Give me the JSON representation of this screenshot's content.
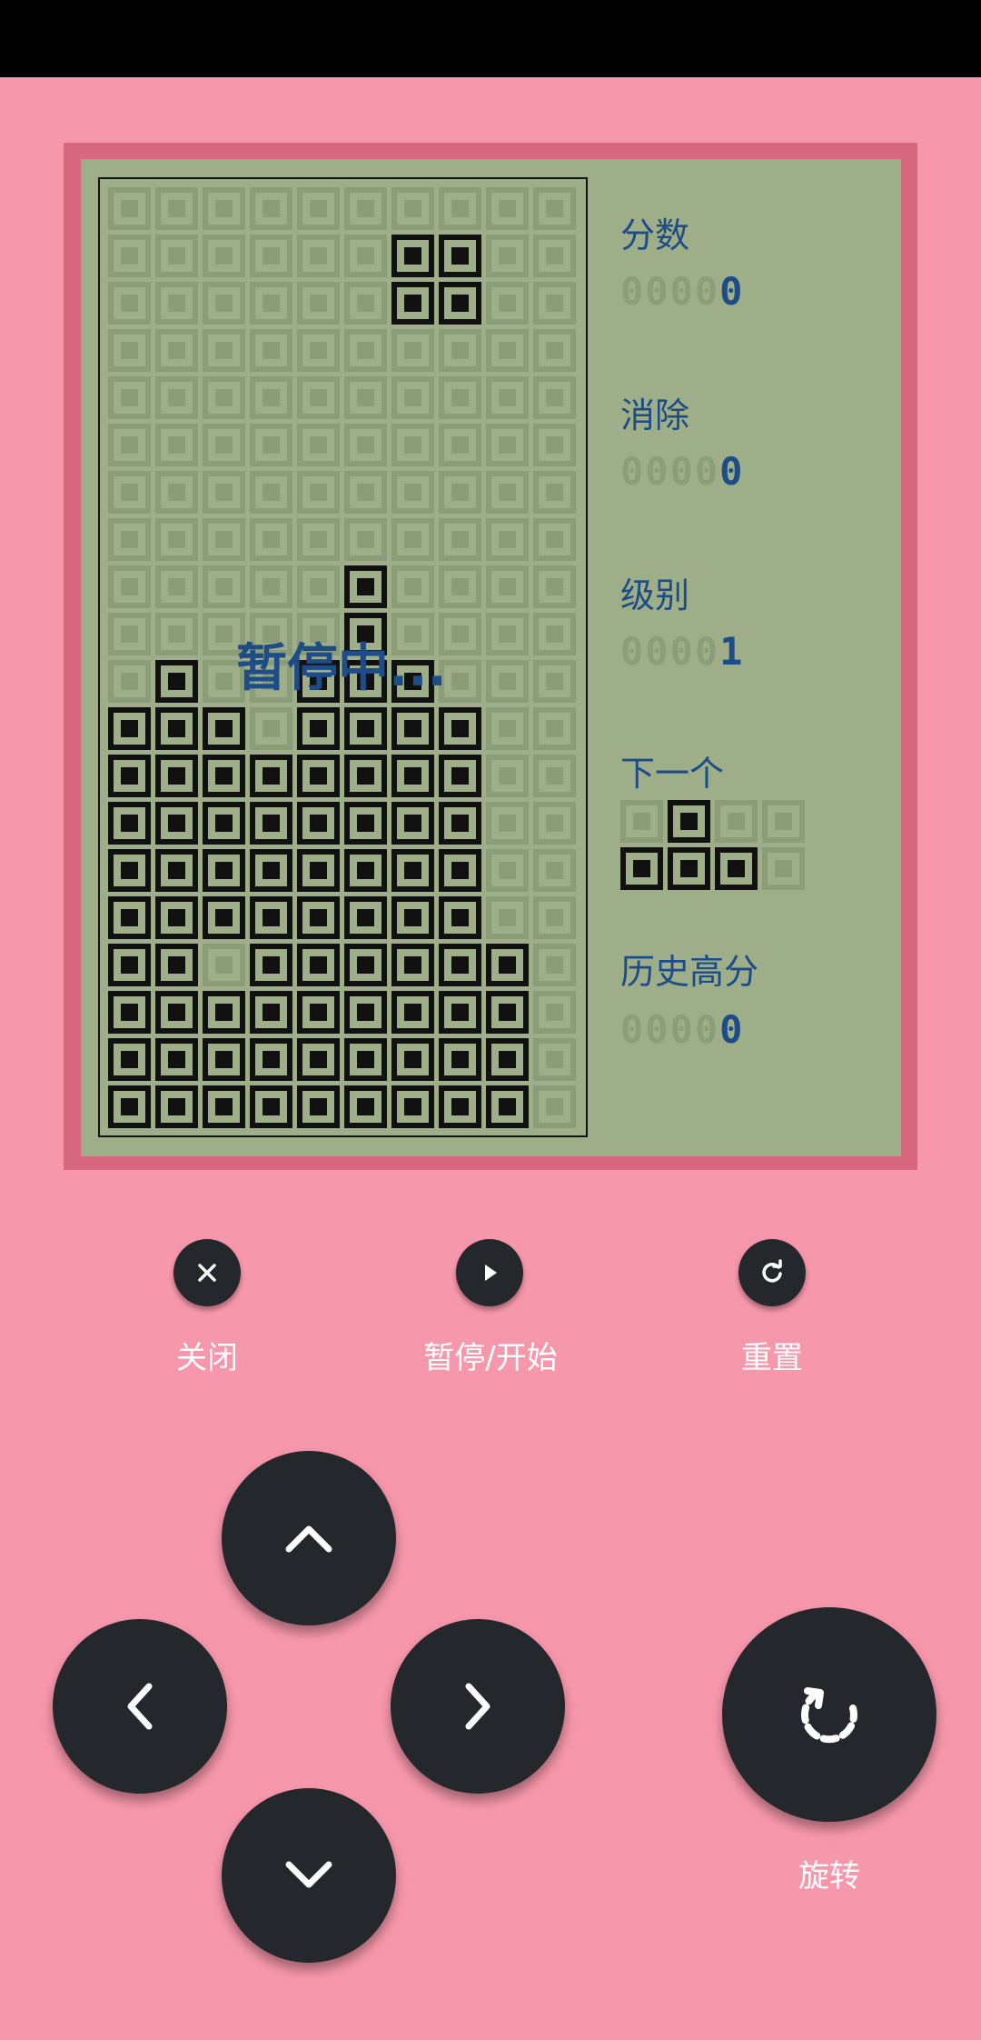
{
  "game": {
    "paused_text": "暂停中...",
    "board": {
      "rows": 20,
      "cols": 10,
      "filled": [
        [
          1,
          6
        ],
        [
          1,
          7
        ],
        [
          2,
          6
        ],
        [
          2,
          7
        ],
        [
          8,
          5
        ],
        [
          9,
          5
        ],
        [
          10,
          1
        ],
        [
          10,
          4
        ],
        [
          10,
          5
        ],
        [
          10,
          6
        ],
        [
          11,
          0
        ],
        [
          11,
          1
        ],
        [
          11,
          2
        ],
        [
          11,
          4
        ],
        [
          11,
          5
        ],
        [
          11,
          6
        ],
        [
          11,
          7
        ],
        [
          12,
          0
        ],
        [
          12,
          1
        ],
        [
          12,
          2
        ],
        [
          12,
          3
        ],
        [
          12,
          4
        ],
        [
          12,
          5
        ],
        [
          12,
          6
        ],
        [
          12,
          7
        ],
        [
          13,
          0
        ],
        [
          13,
          1
        ],
        [
          13,
          2
        ],
        [
          13,
          3
        ],
        [
          13,
          4
        ],
        [
          13,
          5
        ],
        [
          13,
          6
        ],
        [
          13,
          7
        ],
        [
          14,
          0
        ],
        [
          14,
          1
        ],
        [
          14,
          2
        ],
        [
          14,
          3
        ],
        [
          14,
          4
        ],
        [
          14,
          5
        ],
        [
          14,
          6
        ],
        [
          14,
          7
        ],
        [
          15,
          0
        ],
        [
          15,
          1
        ],
        [
          15,
          2
        ],
        [
          15,
          3
        ],
        [
          15,
          4
        ],
        [
          15,
          5
        ],
        [
          15,
          6
        ],
        [
          15,
          7
        ],
        [
          16,
          0
        ],
        [
          16,
          1
        ],
        [
          16,
          3
        ],
        [
          16,
          4
        ],
        [
          16,
          5
        ],
        [
          16,
          6
        ],
        [
          16,
          7
        ],
        [
          16,
          8
        ],
        [
          17,
          0
        ],
        [
          17,
          1
        ],
        [
          17,
          2
        ],
        [
          17,
          3
        ],
        [
          17,
          4
        ],
        [
          17,
          5
        ],
        [
          17,
          6
        ],
        [
          17,
          7
        ],
        [
          17,
          8
        ],
        [
          18,
          0
        ],
        [
          18,
          1
        ],
        [
          18,
          2
        ],
        [
          18,
          3
        ],
        [
          18,
          4
        ],
        [
          18,
          5
        ],
        [
          18,
          6
        ],
        [
          18,
          7
        ],
        [
          18,
          8
        ],
        [
          19,
          0
        ],
        [
          19,
          1
        ],
        [
          19,
          2
        ],
        [
          19,
          3
        ],
        [
          19,
          4
        ],
        [
          19,
          5
        ],
        [
          19,
          6
        ],
        [
          19,
          7
        ],
        [
          19,
          8
        ]
      ]
    }
  },
  "panel": {
    "score_label": "分数",
    "score_ghost": "0000",
    "score_value": "0",
    "lines_label": "消除",
    "lines_ghost": "0000",
    "lines_value": "0",
    "level_label": "级别",
    "level_ghost": "0000",
    "level_value": "1",
    "next_label": "下一个",
    "next_piece": {
      "rows": 2,
      "cols": 4,
      "filled": [
        [
          0,
          1
        ],
        [
          1,
          0
        ],
        [
          1,
          1
        ],
        [
          1,
          2
        ]
      ]
    },
    "high_label": "历史高分",
    "high_ghost": "0000",
    "high_value": "0"
  },
  "controls": {
    "close_label": "关闭",
    "pause_label": "暂停/开始",
    "reset_label": "重置",
    "rotate_label": "旋转",
    "icons": {
      "close": "close-icon",
      "play": "play-icon",
      "reset": "refresh-icon",
      "up": "chevron-up-icon",
      "down": "chevron-down-icon",
      "left": "chevron-left-icon",
      "right": "chevron-right-icon",
      "rotate": "rotate-icon"
    }
  },
  "colors": {
    "background": "#f797ab",
    "screen": "#9dae89",
    "cell_on": "#111111",
    "cell_off": "#8b9c78",
    "text_blue": "#1e4c86",
    "button": "#24272b"
  }
}
